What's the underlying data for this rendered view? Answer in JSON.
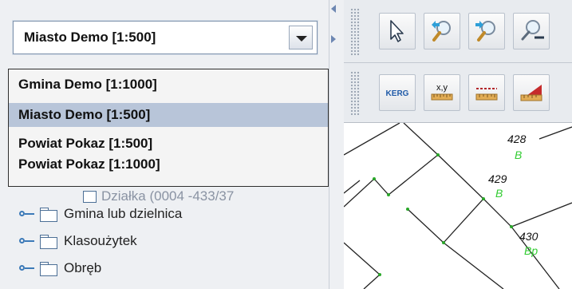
{
  "layer_select": {
    "selected": "Miasto Demo [1:500]",
    "options": [
      "Gmina Demo [1:1000]",
      "Miasto Demo [1:500]",
      "Powiat Pokaz [1:500]",
      "Powiat Pokaz [1:1000]"
    ]
  },
  "tree": {
    "hidden_item": "Działka (0004 -433/37",
    "items": [
      "Gmina lub dzielnica",
      "Klasoużytek",
      "Obręb"
    ]
  },
  "toolbar": {
    "kerg_label": "KERG",
    "xy_label": "x,y"
  },
  "map": {
    "parcels": [
      {
        "number": "428",
        "class": "B"
      },
      {
        "number": "429",
        "class": "B"
      },
      {
        "number": "430",
        "class": "Bp"
      }
    ],
    "colors": {
      "parcel_number": "#111111",
      "land_class": "#33cc33",
      "lines": "#222222"
    }
  },
  "icons": [
    "select-arrow-icon",
    "zoom-prev-icon",
    "zoom-next-icon",
    "zoom-out-icon",
    "kerg-icon",
    "coordinates-icon",
    "measure-distance-icon",
    "measure-area-icon"
  ]
}
